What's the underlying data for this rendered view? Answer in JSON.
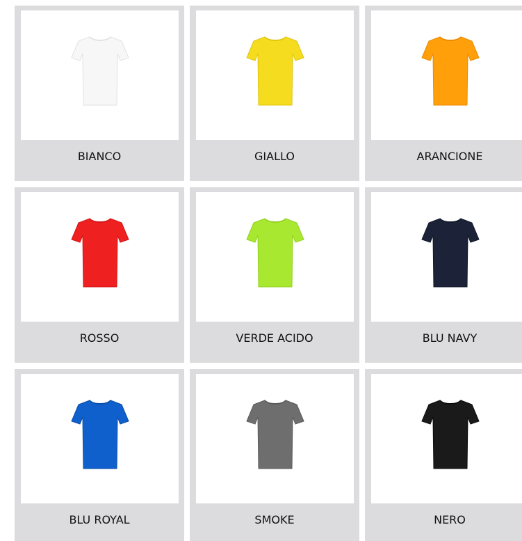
{
  "swatches": [
    {
      "label": "BIANCO",
      "color": "#f7f7f7",
      "stroke": "#e2e2e2",
      "icon": "white-tshirt-icon"
    },
    {
      "label": "GIALLO",
      "color": "#f5dc1e",
      "stroke": "#e0c40e",
      "icon": "yellow-tshirt-icon"
    },
    {
      "label": "ARANCIONE",
      "color": "#ff9f0a",
      "stroke": "#e88a00",
      "icon": "orange-tshirt-icon"
    },
    {
      "label": "ROSSO",
      "color": "#ef2020",
      "stroke": "#d11414",
      "icon": "red-tshirt-icon"
    },
    {
      "label": "VERDE ACIDO",
      "color": "#a8e830",
      "stroke": "#92d01c",
      "icon": "acid-green-tshirt-icon"
    },
    {
      "label": "BLU NAVY",
      "color": "#1c2338",
      "stroke": "#121828",
      "icon": "navy-blue-tshirt-icon"
    },
    {
      "label": "BLU ROYAL",
      "color": "#0f5fcc",
      "stroke": "#0a4eaa",
      "icon": "royal-blue-tshirt-icon"
    },
    {
      "label": "SMOKE",
      "color": "#6e6e6e",
      "stroke": "#5a5a5a",
      "icon": "smoke-tshirt-icon"
    },
    {
      "label": "NERO",
      "color": "#1a1a1a",
      "stroke": "#0c0c0c",
      "icon": "black-tshirt-icon"
    }
  ]
}
